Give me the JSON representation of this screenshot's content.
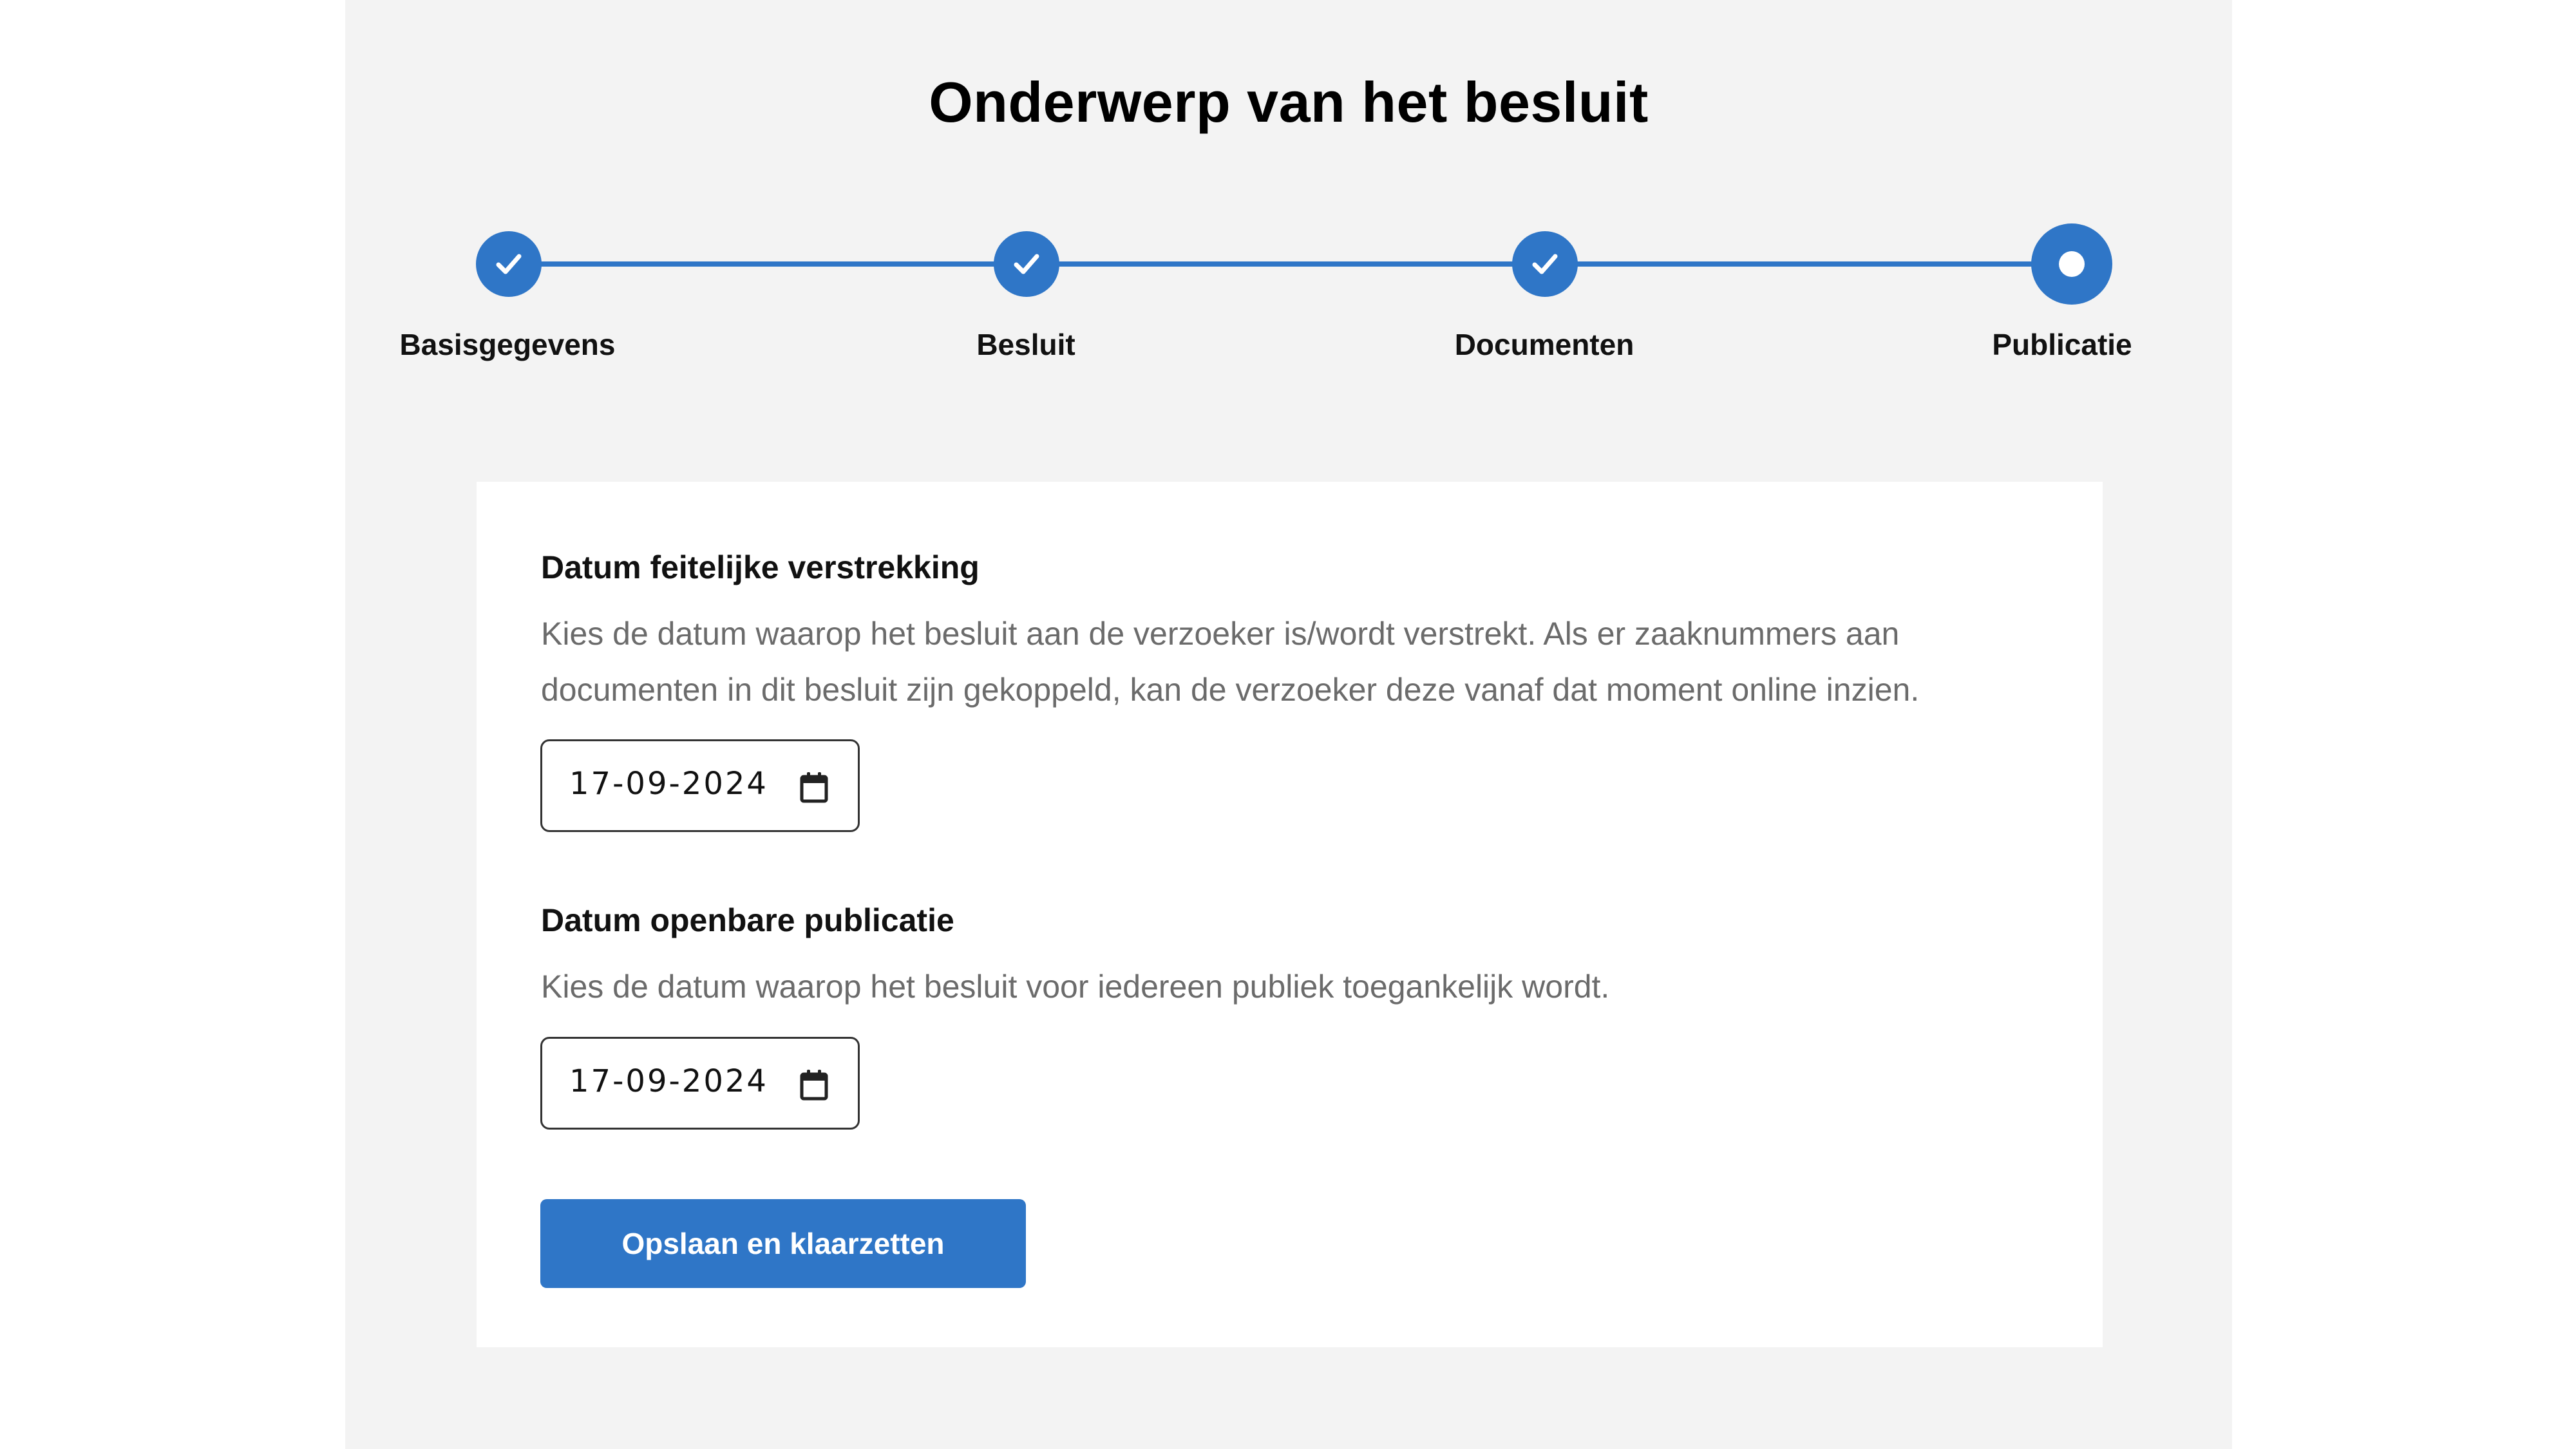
{
  "page": {
    "title": "Onderwerp van het besluit"
  },
  "stepper": {
    "steps": [
      {
        "label": "Basisgegevens",
        "state": "completed"
      },
      {
        "label": "Besluit",
        "state": "completed"
      },
      {
        "label": "Documenten",
        "state": "completed"
      },
      {
        "label": "Publicatie",
        "state": "current"
      }
    ]
  },
  "form": {
    "fields": [
      {
        "label": "Datum feitelijke verstrekking",
        "help": "Kies de datum waarop het besluit aan de verzoeker is/wordt verstrekt. Als er zaaknummers aan documenten in dit besluit zijn gekoppeld, kan de verzoeker deze vanaf dat moment online inzien.",
        "value": "17-09-2024"
      },
      {
        "label": "Datum openbare publicatie",
        "help": "Kies de datum waarop het besluit voor iedereen publiek toegankelijk wordt.",
        "value": "17-09-2024"
      }
    ],
    "submit_label": "Opslaan en klaarzetten"
  },
  "icons": {
    "step_done": "checkmark-icon",
    "step_current": "dot-icon",
    "date_picker": "calendar-icon"
  },
  "colors": {
    "accent": "#2f76c7",
    "page_background": "#f3f3f3",
    "card_background": "#ffffff",
    "help_text": "#6b6b6b"
  }
}
